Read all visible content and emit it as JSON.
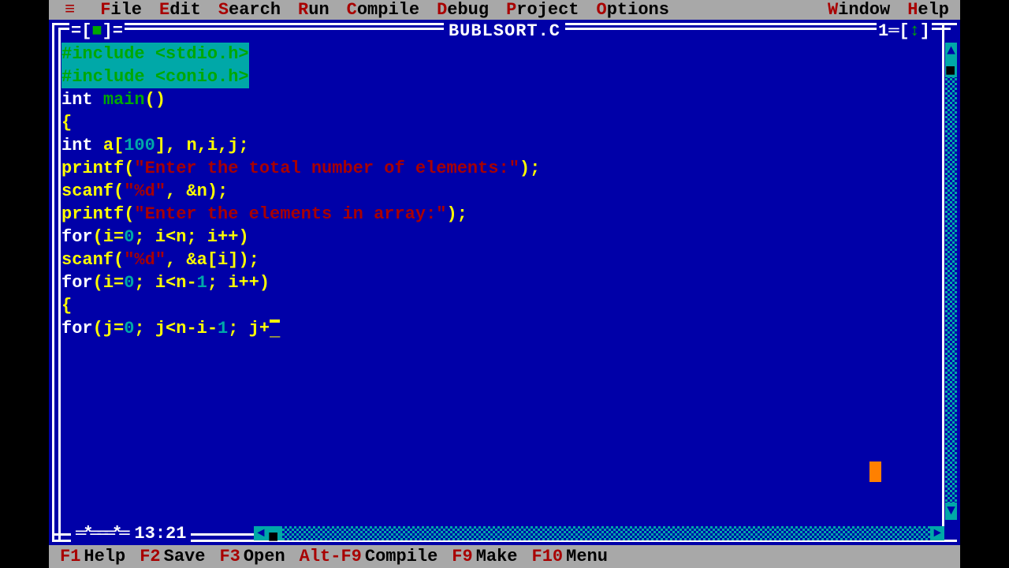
{
  "menubar": {
    "icon": "≡",
    "items": [
      {
        "hot": "F",
        "rest": "ile"
      },
      {
        "hot": "E",
        "rest": "dit"
      },
      {
        "hot": "S",
        "rest": "earch"
      },
      {
        "hot": "R",
        "rest": "un"
      },
      {
        "hot": "C",
        "rest": "ompile"
      },
      {
        "hot": "D",
        "rest": "ebug"
      },
      {
        "hot": "P",
        "rest": "roject"
      },
      {
        "hot": "O",
        "rest": "ptions"
      },
      {
        "hot": "W",
        "rest": "indow"
      },
      {
        "hot": "H",
        "rest": "elp"
      }
    ]
  },
  "window": {
    "close_glyph": "[■]",
    "title": "BUBLSORT.C",
    "window_number": "1",
    "zoom_glyph": "=[↕]",
    "cursor_pos": "13:21",
    "modified_glyph": "═*═══*═"
  },
  "code": {
    "lines": [
      {
        "sel": true,
        "tokens": [
          [
            "pp",
            "#include <stdio.h>"
          ]
        ]
      },
      {
        "sel": true,
        "tokens": [
          [
            "pp",
            "#include <conio.h>"
          ]
        ]
      },
      {
        "sel": false,
        "tokens": [
          [
            "kw",
            "int "
          ],
          [
            "fn",
            "main"
          ],
          [
            "pun",
            "()"
          ]
        ]
      },
      {
        "sel": false,
        "tokens": [
          [
            "pun",
            "{"
          ]
        ]
      },
      {
        "sel": false,
        "tokens": [
          [
            "kw",
            "int "
          ],
          [
            "id",
            "a"
          ],
          [
            "pun",
            "["
          ],
          [
            "num",
            "100"
          ],
          [
            "pun",
            "], "
          ],
          [
            "id",
            "n"
          ],
          [
            "pun",
            ","
          ],
          [
            "id",
            "i"
          ],
          [
            "pun",
            ","
          ],
          [
            "id",
            "j"
          ],
          [
            "pun",
            ";"
          ]
        ]
      },
      {
        "sel": false,
        "tokens": [
          [
            "id",
            "printf"
          ],
          [
            "pun",
            "("
          ],
          [
            "str",
            "\"Enter the total number of elements:\""
          ],
          [
            "pun",
            ");"
          ]
        ]
      },
      {
        "sel": false,
        "tokens": [
          [
            "id",
            "scanf"
          ],
          [
            "pun",
            "("
          ],
          [
            "str",
            "\"%d\""
          ],
          [
            "pun",
            ", &"
          ],
          [
            "id",
            "n"
          ],
          [
            "pun",
            ");"
          ]
        ]
      },
      {
        "sel": false,
        "tokens": [
          [
            "id",
            "printf"
          ],
          [
            "pun",
            "("
          ],
          [
            "str",
            "\"Enter the elements in array:\""
          ],
          [
            "pun",
            ");"
          ]
        ]
      },
      {
        "sel": false,
        "tokens": [
          [
            "kw",
            "for"
          ],
          [
            "pun",
            "("
          ],
          [
            "id",
            "i"
          ],
          [
            "pun",
            "="
          ],
          [
            "num",
            "0"
          ],
          [
            "pun",
            "; "
          ],
          [
            "id",
            "i"
          ],
          [
            "pun",
            "<"
          ],
          [
            "id",
            "n"
          ],
          [
            "pun",
            "; "
          ],
          [
            "id",
            "i"
          ],
          [
            "pun",
            "++)"
          ]
        ]
      },
      {
        "sel": false,
        "tokens": [
          [
            "id",
            "scanf"
          ],
          [
            "pun",
            "("
          ],
          [
            "str",
            "\"%d\""
          ],
          [
            "pun",
            ", &"
          ],
          [
            "id",
            "a"
          ],
          [
            "pun",
            "["
          ],
          [
            "id",
            "i"
          ],
          [
            "pun",
            "]);"
          ]
        ]
      },
      {
        "sel": false,
        "tokens": [
          [
            "kw",
            "for"
          ],
          [
            "pun",
            "("
          ],
          [
            "id",
            "i"
          ],
          [
            "pun",
            "="
          ],
          [
            "num",
            "0"
          ],
          [
            "pun",
            "; "
          ],
          [
            "id",
            "i"
          ],
          [
            "pun",
            "<"
          ],
          [
            "id",
            "n"
          ],
          [
            "pun",
            "-"
          ],
          [
            "num",
            "1"
          ],
          [
            "pun",
            "; "
          ],
          [
            "id",
            "i"
          ],
          [
            "pun",
            "++)"
          ]
        ]
      },
      {
        "sel": false,
        "tokens": [
          [
            "pun",
            "{"
          ]
        ]
      },
      {
        "sel": false,
        "tokens": [
          [
            "kw",
            "for"
          ],
          [
            "pun",
            "("
          ],
          [
            "id",
            "j"
          ],
          [
            "pun",
            "="
          ],
          [
            "num",
            "0"
          ],
          [
            "pun",
            "; "
          ],
          [
            "id",
            "j"
          ],
          [
            "pun",
            "<"
          ],
          [
            "id",
            "n"
          ],
          [
            "pun",
            "-"
          ],
          [
            "id",
            "i"
          ],
          [
            "pun",
            "-"
          ],
          [
            "num",
            "1"
          ],
          [
            "pun",
            "; "
          ],
          [
            "id",
            "j"
          ],
          [
            "pun",
            "+"
          ],
          [
            "cur",
            "_"
          ]
        ]
      }
    ]
  },
  "fnbar": [
    {
      "key": "F1",
      "label": "Help"
    },
    {
      "key": "F2",
      "label": "Save"
    },
    {
      "key": "F3",
      "label": "Open"
    },
    {
      "key": "Alt-F9",
      "label": "Compile"
    },
    {
      "key": "F9",
      "label": "Make"
    },
    {
      "key": "F10",
      "label": "Menu"
    }
  ]
}
